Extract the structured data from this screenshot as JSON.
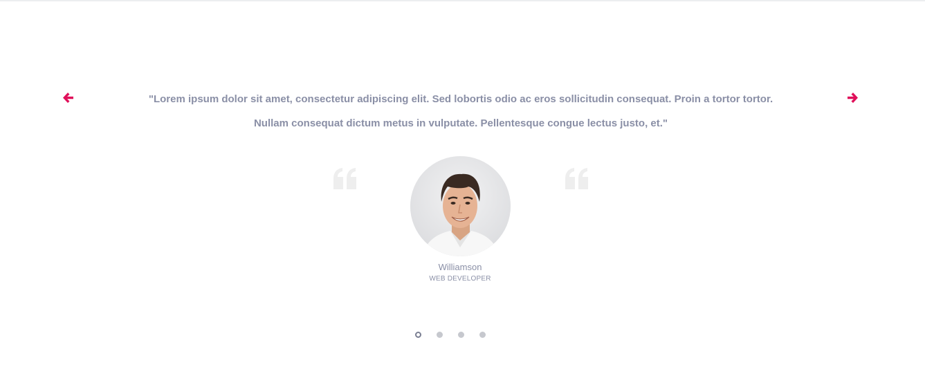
{
  "testimonial": {
    "quote_line1": "\"Lorem ipsum dolor sit amet, consectetur adipiscing elit. Sed lobortis odio ac eros sollicitudin consequat. Proin a tortor tortor.",
    "quote_line2": "Nullam consequat dictum metus in vulputate. Pellentesque congue lectus justo, et.\"",
    "name": "Williamson",
    "role": "WEB DEVELOPER"
  },
  "navigation": {
    "prev_icon": "arrow-left-icon",
    "next_icon": "arrow-right-icon",
    "accent_color": "#e0105a"
  },
  "pagination": {
    "total": 4,
    "active_index": 0
  },
  "colors": {
    "text": "#8a8fa6",
    "quote_mark": "#eeeeee"
  }
}
